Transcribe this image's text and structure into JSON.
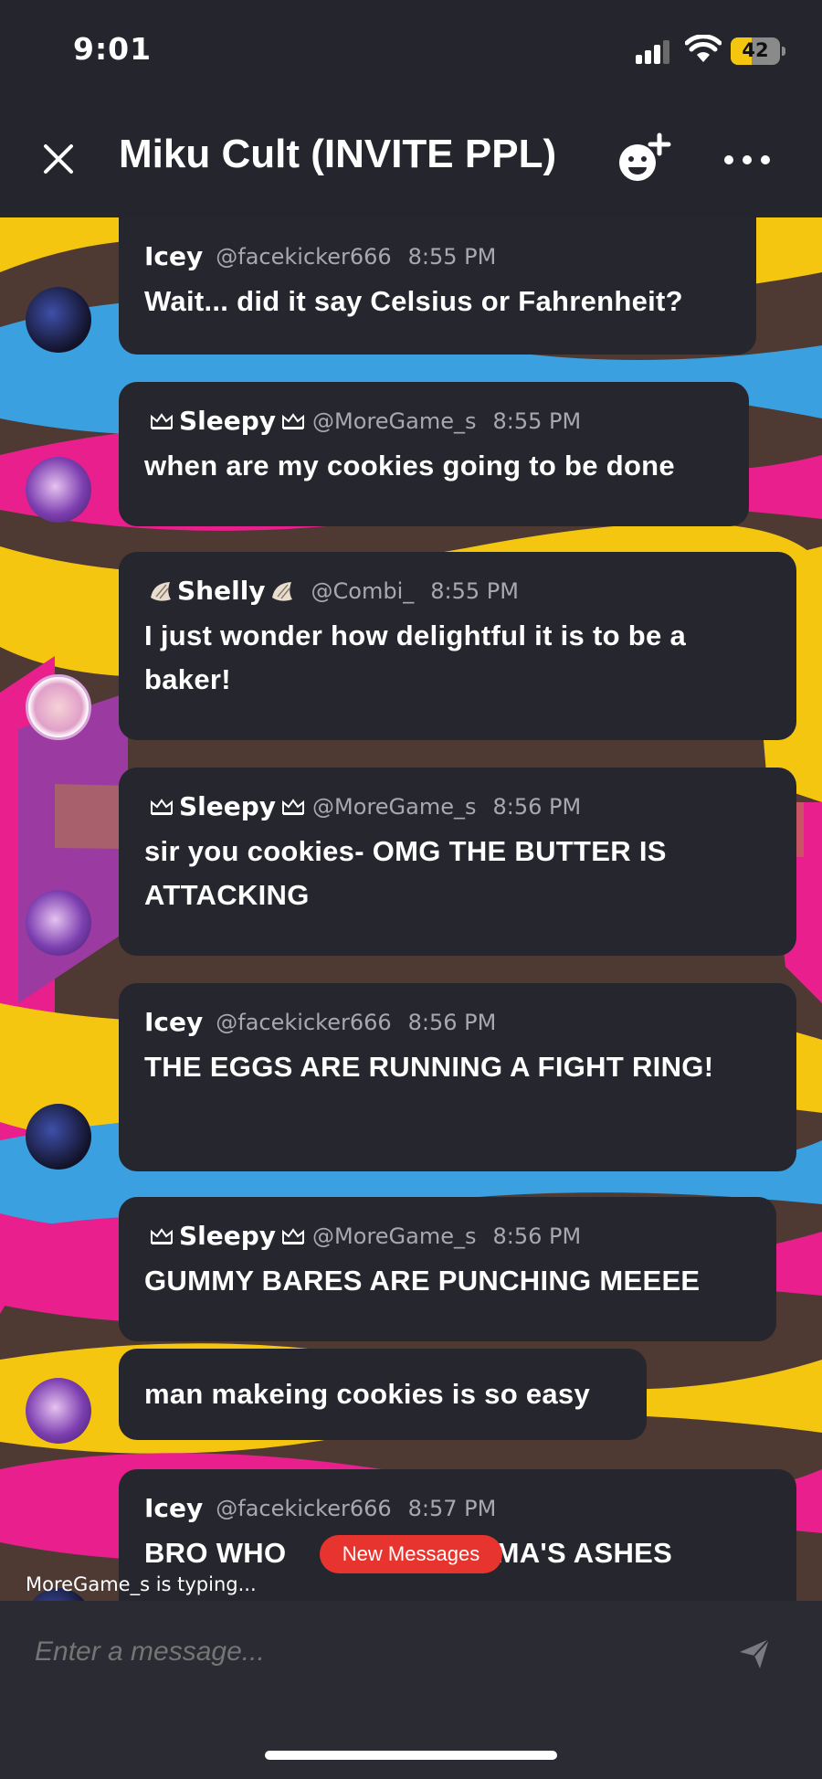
{
  "status_bar": {
    "time": "9:01",
    "battery": "42",
    "battery_level": 0.42
  },
  "header": {
    "title": "Miku Cult (INVITE PPL)",
    "close_icon": "close-icon",
    "add_member_icon": "add-member-icon",
    "more_icon": "more-icon"
  },
  "messages": [
    {
      "name": "Icey",
      "handle": "@facekicker666",
      "time": "8:55 PM",
      "text": "Wait... did it say Celsius or Fahrenheit?",
      "decor": "none"
    },
    {
      "name": "Sleepy",
      "handle": "@MoreGame_s",
      "time": "8:55 PM",
      "text": "when are my cookies going to be done",
      "decor": "crown"
    },
    {
      "name": "Shelly",
      "handle": "@Combi_",
      "time": "8:55 PM",
      "text": "I just wonder how delightful it is to be a baker!",
      "decor": "shell"
    },
    {
      "name": "Sleepy",
      "handle": "@MoreGame_s",
      "time": "8:56 PM",
      "text": "sir you cookies- OMG THE BUTTER IS ATTACKING",
      "decor": "crown"
    },
    {
      "name": "Icey",
      "handle": "@facekicker666",
      "time": "8:56 PM",
      "text": "THE EGGS ARE RUNNING A FIGHT RING!",
      "decor": "none"
    },
    {
      "name": "Sleepy",
      "handle": "@MoreGame_s",
      "time": "8:56 PM",
      "text": "GUMMY BARES ARE PUNCHING MEEEE",
      "decor": "crown"
    },
    {
      "text": "man makeing cookies is so easy"
    },
    {
      "name": "Icey",
      "handle": "@facekicker666",
      "time": "8:57 PM",
      "text": "BRO WHO",
      "text_tail": "NDMA'S ASHES"
    }
  ],
  "typing_indicator": "MoreGame_s is typing...",
  "new_messages_badge": "New Messages",
  "composer": {
    "placeholder": "Enter a message...",
    "send_icon": "send-icon"
  },
  "colors": {
    "background": "#25252e",
    "bubble": "#26262e",
    "badge": "#e8342e",
    "wallpaper": [
      "#f5c60f",
      "#3aa0e0",
      "#e81f8c",
      "#4e3a33",
      "#9b3aa0"
    ]
  }
}
